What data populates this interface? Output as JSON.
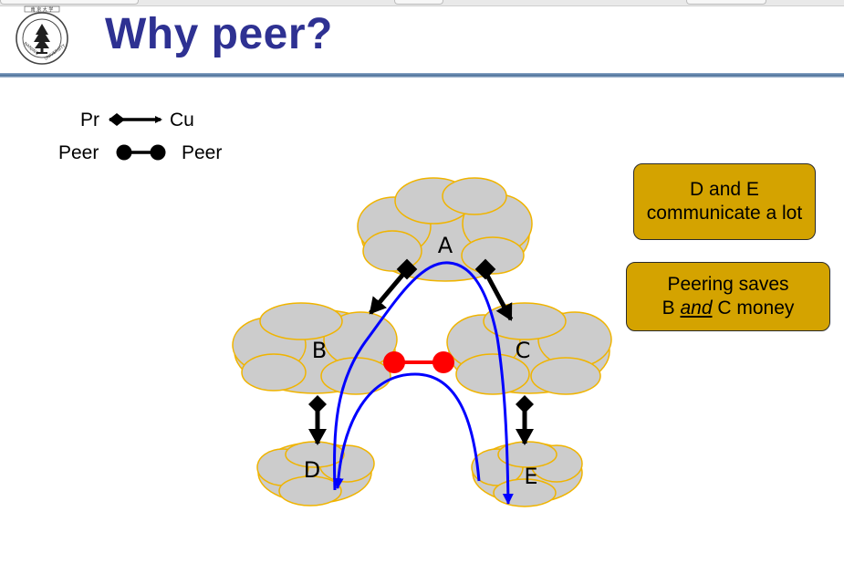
{
  "slide": {
    "title": "Why peer?"
  },
  "legend": {
    "provider_label": "Pr",
    "customer_label": "Cu",
    "peer_left_label": "Peer",
    "peer_right_label": "Peer"
  },
  "nodes": {
    "a": "A",
    "b": "B",
    "c": "C",
    "d": "D",
    "e": "E"
  },
  "callouts": {
    "box1_line1": "D and E",
    "box1_line2": "communicate a lot",
    "box2_line1": "Peering saves",
    "box2_line2_pre": "B",
    "box2_line2_em": "and",
    "box2_line2_post": "C money"
  },
  "colors": {
    "title": "#2e3192",
    "cloud_fill": "#cccccc",
    "cloud_outline": "#f0b400",
    "peer_link": "#ff0000",
    "traffic_path": "#0000ff",
    "callout_fill": "#d4a300"
  }
}
